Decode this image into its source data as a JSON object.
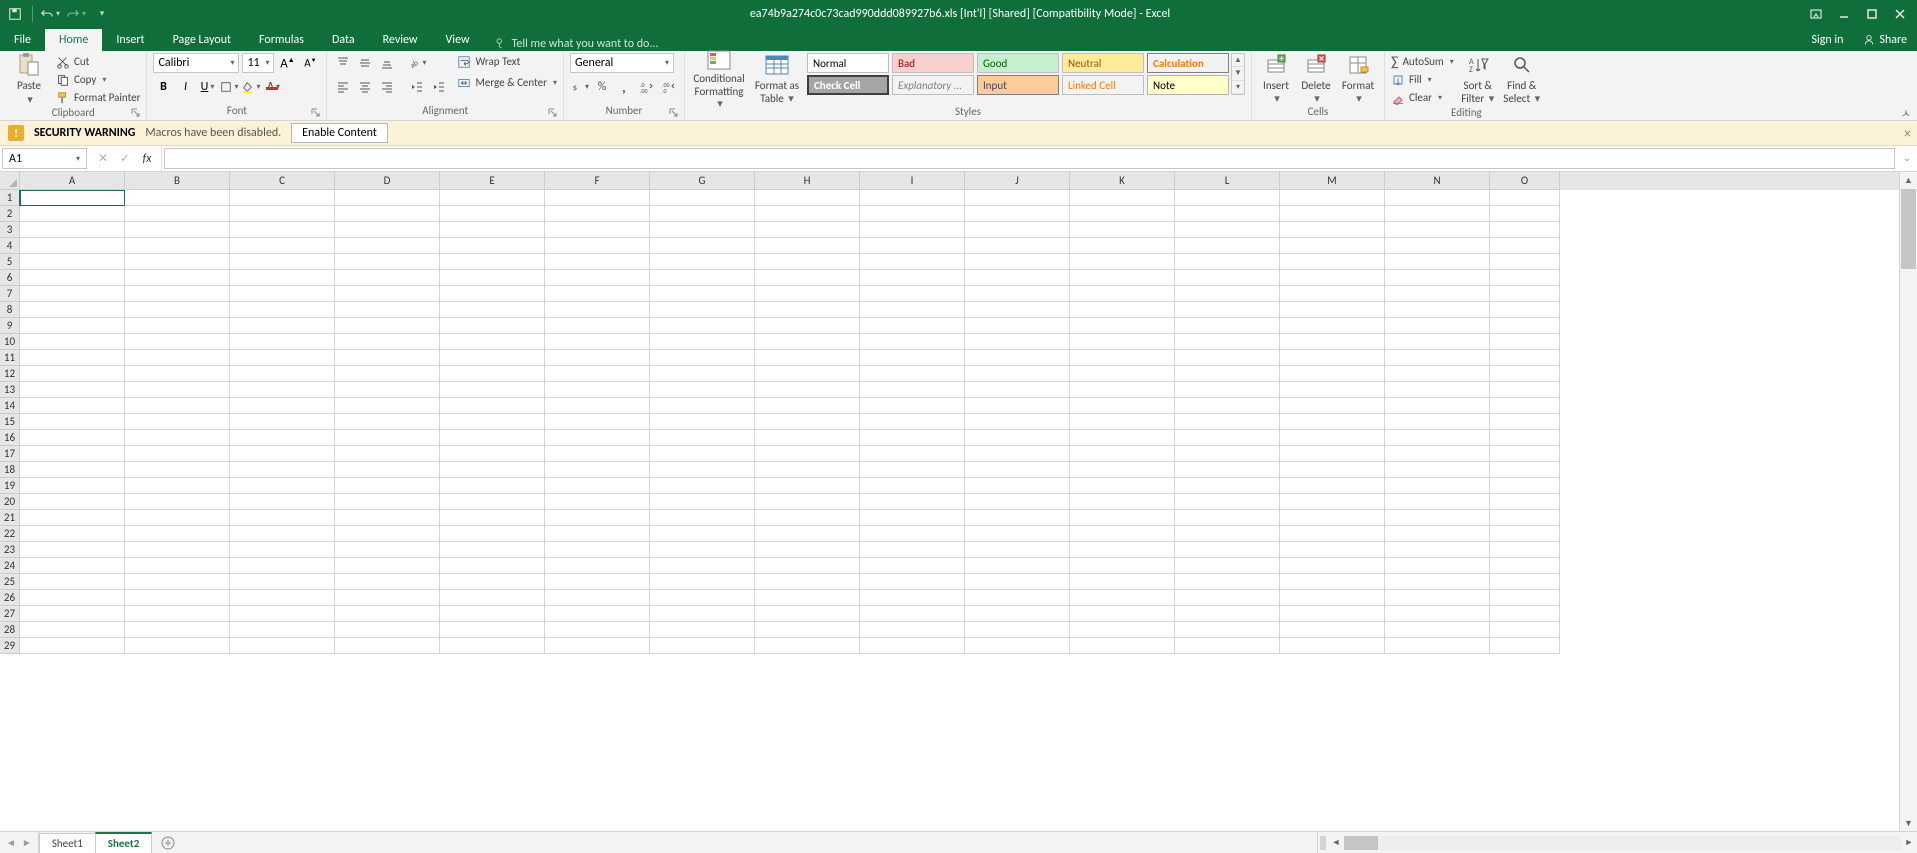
{
  "title": "ea74b9a274c0c73cad990ddd089927b6.xls  [Int'l]  [Shared]  [Compatibility Mode] - Excel",
  "tabs": {
    "file": "File",
    "list": [
      "Home",
      "Insert",
      "Page Layout",
      "Formulas",
      "Data",
      "Review",
      "View"
    ],
    "active": "Home",
    "tellme": "Tell me what you want to do...",
    "signin": "Sign in",
    "share": "Share"
  },
  "clipboard": {
    "paste": "Paste",
    "cut": "Cut",
    "copy": "Copy",
    "fmtpaint": "Format Painter",
    "label": "Clipboard"
  },
  "font": {
    "name": "Calibri",
    "size": "11",
    "label": "Font"
  },
  "alignment": {
    "wrap": "Wrap Text",
    "merge": "Merge & Center",
    "label": "Alignment"
  },
  "number": {
    "format": "General",
    "label": "Number"
  },
  "styles": {
    "cond": "Conditional Formatting",
    "cond1": "Conditional",
    "cond2": "Formatting",
    "fmt1": "Format as",
    "fmt2": "Table",
    "cells": {
      "normal": "Normal",
      "bad": "Bad",
      "good": "Good",
      "neutral": "Neutral",
      "calculation": "Calculation",
      "checkcell": "Check Cell",
      "explanatory": "Explanatory ...",
      "input": "Input",
      "linkedcell": "Linked Cell",
      "note": "Note"
    },
    "label": "Styles"
  },
  "cells": {
    "insert": "Insert",
    "delete": "Delete",
    "format": "Format",
    "label": "Cells"
  },
  "editing": {
    "autosum": "AutoSum",
    "fill": "Fill",
    "clear": "Clear",
    "sort1": "Sort &",
    "sort2": "Filter",
    "find1": "Find &",
    "find2": "Select",
    "label": "Editing"
  },
  "security": {
    "title": "SECURITY WARNING",
    "msg": "Macros have been disabled.",
    "btn": "Enable Content"
  },
  "namebox": "A1",
  "columns": [
    "A",
    "B",
    "C",
    "D",
    "E",
    "F",
    "G",
    "H",
    "I",
    "J",
    "K",
    "L",
    "M",
    "N",
    "O"
  ],
  "rowcount": 29,
  "sheets": [
    "Sheet1",
    "Sheet2"
  ],
  "activeSheet": "Sheet2"
}
